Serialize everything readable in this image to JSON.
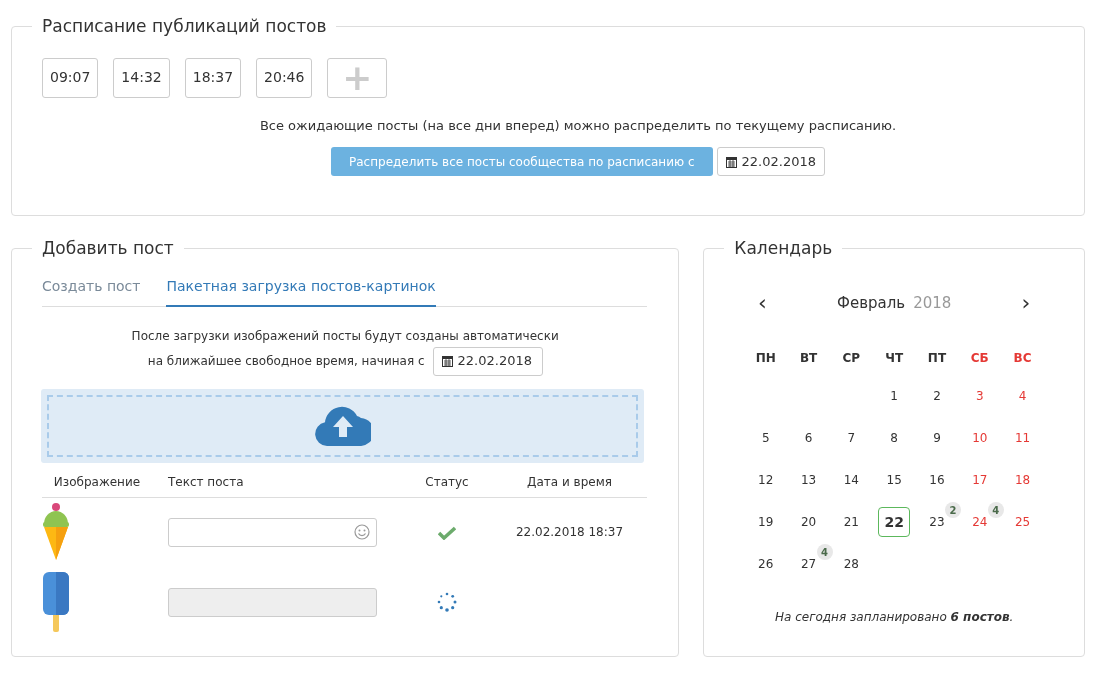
{
  "schedule": {
    "title": "Расписание публикаций постов",
    "times": [
      "09:07",
      "14:32",
      "18:37",
      "20:46"
    ],
    "add_button": "+",
    "note": "Все ожидающие посты (на все дни вперед) можно распределить по текущему расписанию.",
    "distribute_button": "Распределить все посты сообщества по расписанию с",
    "date": "22.02.2018"
  },
  "add_post": {
    "title": "Добавить пост",
    "tabs": [
      {
        "label": "Создать пост",
        "selected": false
      },
      {
        "label": "Пакетная загрузка постов-картинок",
        "selected": true
      }
    ],
    "note_line1": "После загрузки изображений посты будут созданы автоматически",
    "note_line2": "на ближайшее свободное время, начиная с",
    "date": "22.02.2018",
    "columns": [
      "Изображение",
      "Текст поста",
      "Статус",
      "Дата и время"
    ],
    "rows": [
      {
        "kind": "cone",
        "disabled": false,
        "done": true,
        "datetime": "22.02.2018 18:37"
      },
      {
        "kind": "popsicle",
        "disabled": true,
        "done": false
      }
    ]
  },
  "calendar": {
    "title": "Календарь",
    "prev": "‹",
    "next": "›",
    "month": "Февраль",
    "year": "2018",
    "weekdays": [
      {
        "label": "ПН",
        "weekend": false
      },
      {
        "label": "ВТ",
        "weekend": false
      },
      {
        "label": "СР",
        "weekend": false
      },
      {
        "label": "ЧТ",
        "weekend": false
      },
      {
        "label": "ПТ",
        "weekend": false
      },
      {
        "label": "СБ",
        "weekend": true
      },
      {
        "label": "ВС",
        "weekend": true
      }
    ],
    "days": [
      {
        "day": "1",
        "weekend": false,
        "today": false
      },
      {
        "day": "2",
        "weekend": false,
        "today": false
      },
      {
        "day": "3",
        "weekend": true,
        "today": false
      },
      {
        "day": "4",
        "weekend": true,
        "today": false
      },
      {
        "day": "5",
        "weekend": false,
        "today": false
      },
      {
        "day": "6",
        "weekend": false,
        "today": false
      },
      {
        "day": "7",
        "weekend": false,
        "today": false
      },
      {
        "day": "8",
        "weekend": false,
        "today": false
      },
      {
        "day": "9",
        "weekend": false,
        "today": false
      },
      {
        "day": "10",
        "weekend": true,
        "today": false
      },
      {
        "day": "11",
        "weekend": true,
        "today": false
      },
      {
        "day": "12",
        "weekend": false,
        "today": false
      },
      {
        "day": "13",
        "weekend": false,
        "today": false
      },
      {
        "day": "14",
        "weekend": false,
        "today": false
      },
      {
        "day": "15",
        "weekend": false,
        "today": false
      },
      {
        "day": "16",
        "weekend": false,
        "today": false
      },
      {
        "day": "17",
        "weekend": true,
        "today": false
      },
      {
        "day": "18",
        "weekend": true,
        "today": false
      },
      {
        "day": "19",
        "weekend": false,
        "today": false
      },
      {
        "day": "20",
        "weekend": false,
        "today": false
      },
      {
        "day": "21",
        "weekend": false,
        "today": false
      },
      {
        "day": "22",
        "weekend": false,
        "today": true
      },
      {
        "day": "23",
        "weekend": false,
        "today": false,
        "badge": "2"
      },
      {
        "day": "24",
        "weekend": true,
        "today": false,
        "badge": "4"
      },
      {
        "day": "25",
        "weekend": true,
        "today": false
      },
      {
        "day": "26",
        "weekend": false,
        "today": false
      },
      {
        "day": "27",
        "weekend": false,
        "today": false,
        "badge": "4"
      },
      {
        "day": "28",
        "weekend": false,
        "today": false
      }
    ],
    "summary": "На сегодня запланировано **6 постов**."
  }
}
